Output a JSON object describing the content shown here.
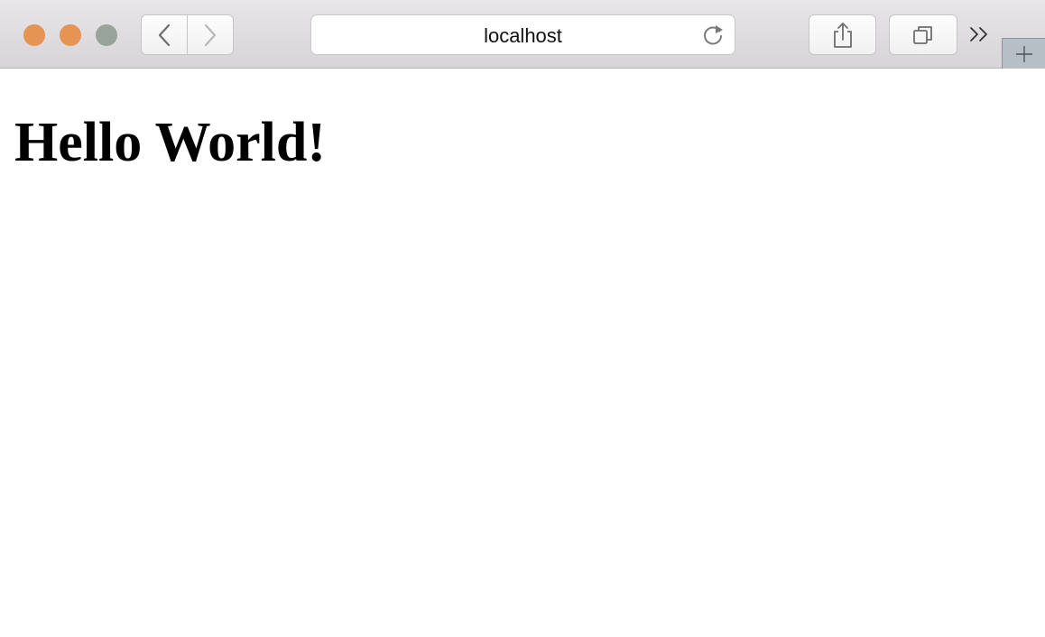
{
  "window": {
    "controls": {
      "close_color": "#e59454",
      "minimize_color": "#e59454",
      "zoom_color": "#98a39a"
    }
  },
  "toolbar": {
    "back_icon": "chevron-left-icon",
    "forward_icon": "chevron-right-icon",
    "address": "localhost",
    "reload_icon": "reload-icon",
    "share_icon": "share-icon",
    "tabs_icon": "tab-overview-icon",
    "overflow_icon": "double-chevron-right-icon",
    "new_tab_icon": "plus-icon"
  },
  "page": {
    "heading": "Hello World!"
  }
}
